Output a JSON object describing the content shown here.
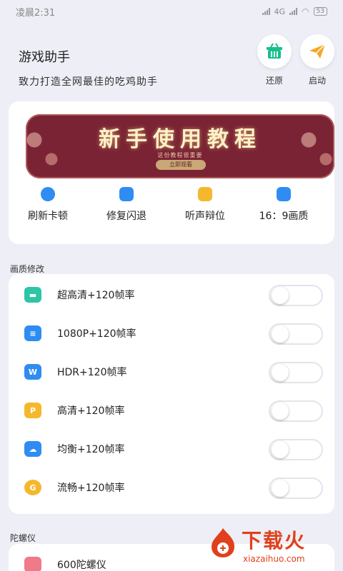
{
  "status_bar": {
    "time": "凌晨2:31",
    "network": "4G",
    "battery": "53"
  },
  "header": {
    "title": "游戏助手",
    "subtitle": "致力打造全网最佳的吃鸡助手",
    "restore_label": "还原",
    "restore_icon": "basket-icon",
    "launch_label": "启动",
    "launch_icon": "paper-plane-icon"
  },
  "banner": {
    "title": "新手使用教程",
    "subtitle": "这份教程很重要",
    "button": "立即观看"
  },
  "quick_actions": [
    {
      "label": "刷新卡顿",
      "icon": "refresh-icon",
      "color": "#2f8cf3"
    },
    {
      "label": "修复闪退",
      "icon": "fix-icon",
      "color": "#2f8cf3"
    },
    {
      "label": "听声辩位",
      "icon": "sound-icon",
      "color": "#f5b82d"
    },
    {
      "label": "16：9画质",
      "icon": "ratio-icon",
      "color": "#2f8cf3"
    }
  ],
  "quality_section": {
    "title": "画质修改",
    "items": [
      {
        "label": "超高清+120帧率",
        "icon": "ultra-hd-icon",
        "color": "#2ec4a6",
        "glyph": "▬",
        "enabled": false
      },
      {
        "label": "1080P+120帧率",
        "icon": "layers-icon",
        "color": "#2f8cf3",
        "glyph": "≡",
        "enabled": false
      },
      {
        "label": "HDR+120帧率",
        "icon": "word-icon",
        "color": "#2f8cf3",
        "glyph": "W",
        "enabled": false
      },
      {
        "label": "高清+120帧率",
        "icon": "ppt-icon",
        "color": "#f5b82d",
        "glyph": "P",
        "enabled": false
      },
      {
        "label": "均衡+120帧率",
        "icon": "cloud-icon",
        "color": "#2f8cf3",
        "glyph": "☁",
        "enabled": false
      },
      {
        "label": "流畅+120帧率",
        "icon": "g-icon",
        "color": "#f5b82d",
        "glyph": "G",
        "enabled": false
      }
    ]
  },
  "gyro_section": {
    "title": "陀螺仪",
    "items": [
      {
        "label": "600陀螺仪",
        "icon": "gamepad-icon",
        "color": "#f07a8a"
      }
    ]
  },
  "watermark": {
    "text": "下载火",
    "url": "xiazaihuo.com"
  }
}
